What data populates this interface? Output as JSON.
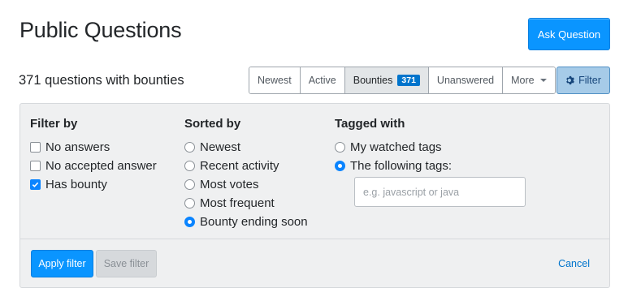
{
  "header": {
    "title": "Public Questions",
    "ask_label": "Ask Question"
  },
  "summary": {
    "count_text": "371 questions with bounties"
  },
  "tabs": [
    {
      "label": "Newest",
      "active": false
    },
    {
      "label": "Active",
      "active": false
    },
    {
      "label": "Bounties",
      "active": true,
      "badge": "371"
    },
    {
      "label": "Unanswered",
      "active": false
    },
    {
      "label": "More",
      "active": false,
      "dropdown": true
    }
  ],
  "filter_button": {
    "label": "Filter",
    "icon": "gear-icon"
  },
  "filter_panel": {
    "filter_by": {
      "heading": "Filter by",
      "options": [
        {
          "label": "No answers",
          "checked": false
        },
        {
          "label": "No accepted answer",
          "checked": false
        },
        {
          "label": "Has bounty",
          "checked": true
        }
      ]
    },
    "sorted_by": {
      "heading": "Sorted by",
      "options": [
        {
          "label": "Newest",
          "selected": false
        },
        {
          "label": "Recent activity",
          "selected": false
        },
        {
          "label": "Most votes",
          "selected": false
        },
        {
          "label": "Most frequent",
          "selected": false
        },
        {
          "label": "Bounty ending soon",
          "selected": true
        }
      ]
    },
    "tagged_with": {
      "heading": "Tagged with",
      "options": [
        {
          "label": "My watched tags",
          "selected": false
        },
        {
          "label": "The following tags:",
          "selected": true
        }
      ],
      "input_value": "",
      "input_placeholder": "e.g. javascript or java"
    },
    "footer": {
      "apply_label": "Apply filter",
      "save_label": "Save filter",
      "cancel_label": "Cancel"
    }
  },
  "colors": {
    "primary": "#0a95ff",
    "link": "#0074cc",
    "panel_bg": "#eff0f1"
  }
}
